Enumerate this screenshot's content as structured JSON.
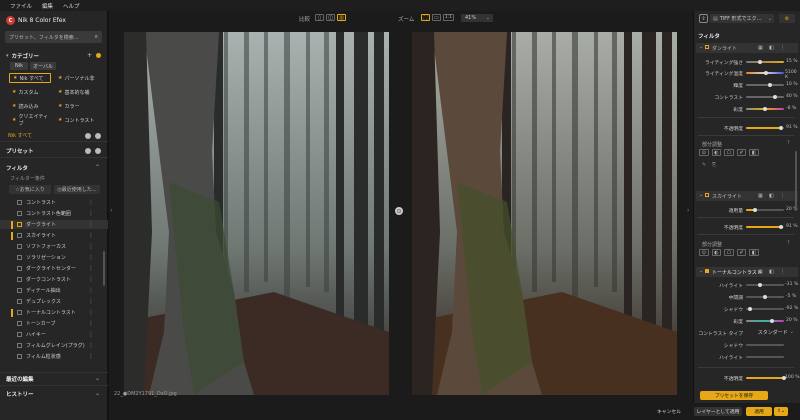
{
  "menu": [
    "ファイル",
    "編集",
    "ヘルプ"
  ],
  "app": {
    "title": "Nik 8 Color Efex"
  },
  "left": {
    "search_placeholder": "プリセット、フィルタを検索...",
    "category_title": "カテゴリー",
    "tags": [
      "Nik",
      "オーバル"
    ],
    "cat_grid": [
      [
        "Nik すべて",
        "パーソナル非"
      ],
      [
        "カスタム",
        "基本的な補"
      ],
      [
        "読み込み",
        "カラー"
      ],
      [
        "クリエイティブ",
        "コントラスト"
      ]
    ],
    "nik_all": "Nik すべて",
    "preset_section": "プリセット",
    "filter_section": "フィルタ",
    "filter_criteria": "フィルター条件",
    "fav_label": "お気に入り",
    "recent_label": "最近使用した...",
    "filters": [
      "コントラスト",
      "コントラスト色範囲",
      "ダークライト",
      "スカイライト",
      "ソフトフォーカス",
      "ソラリゼーション",
      "ダークライトセンター",
      "ダークコントラスト",
      "ディテール抽出",
      "デュプレックス",
      "トーナルコントラスト",
      "トーンカーブ",
      "ハイキー",
      "フィルムグレイン(プラグ)",
      "フィルム粒状感"
    ],
    "recent_edits": "最近の編集",
    "history": "ヒストリー"
  },
  "toolbar": {
    "compare": "比較",
    "zoom": "ズーム",
    "zoom_fit": "1:1",
    "zoom_pct": "41%"
  },
  "photo_filename": "22_●DM2Y1791_DxO.jpg",
  "right": {
    "export": "TIFF 形式でエク...",
    "filter_title": "フィルタ",
    "f1": {
      "name": "ダンライト",
      "rows": [
        {
          "label": "ライティング強さ",
          "value": "15 %"
        },
        {
          "label": "ライティング温度",
          "value": "5100 K"
        },
        {
          "label": "輝度",
          "value": "10 %"
        },
        {
          "label": "コントラスト",
          "value": "40 %"
        },
        {
          "label": "彩度",
          "value": "-8 %"
        }
      ],
      "opacity_label": "不透明度",
      "opacity_value": "91 %"
    },
    "selective_label": "部分調整",
    "f2": {
      "name": "スカイライト",
      "rows": [
        {
          "label": "適用量",
          "value": "20 %"
        }
      ],
      "opacity_label": "不透明度",
      "opacity_value": "91 %"
    },
    "f3": {
      "name": "トーナルコントラスト",
      "rows": [
        {
          "label": "ハイライト",
          "value": "-31 %"
        },
        {
          "label": "中間調",
          "value": "-5 %"
        },
        {
          "label": "シャドウ",
          "value": "-92 %"
        },
        {
          "label": "彩度",
          "value": "20 %"
        }
      ],
      "contrast_type_label": "コントラスト タイプ",
      "contrast_type_value": "スタンダード",
      "extra": [
        "シャドウ",
        "ハイライト"
      ],
      "opacity_label": "不透明度",
      "opacity_value": "100 %"
    },
    "save_preset": "プリセットを保存"
  },
  "bottom": {
    "cancel": "キャンセル",
    "save_as_layer": "レイヤーとして適用",
    "apply": "適用"
  },
  "colors": {
    "accent": "#e6a817",
    "app_red": "#d23a2f"
  }
}
